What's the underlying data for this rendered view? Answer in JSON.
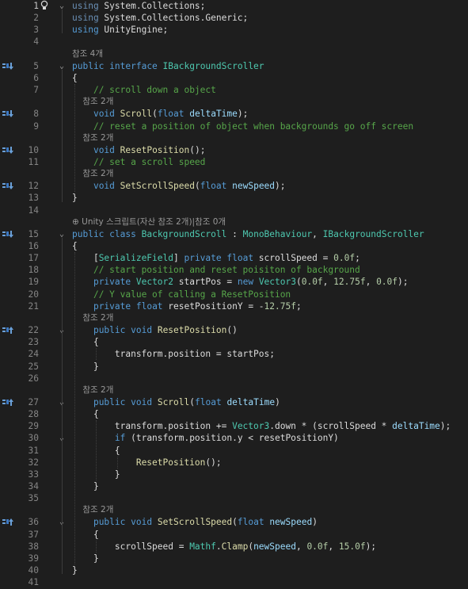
{
  "editor": {
    "language": "csharp",
    "current_line": 1,
    "colors": {
      "background": "#1e1e1e",
      "keyword": "#569cd6",
      "type": "#4ec9b0",
      "method": "#dcdcaa",
      "comment": "#57a64a",
      "number": "#b5cea8",
      "parameter": "#9cdcfe",
      "plain": "#dcdcdc",
      "line_number": "#858585",
      "codelens": "#999999"
    },
    "lines": [
      {
        "n": "1",
        "glyph": "",
        "tokens": [
          [
            "kw",
            "using"
          ],
          [
            "pl",
            " System.Collections;"
          ]
        ]
      },
      {
        "n": "2",
        "glyph": "",
        "tokens": [
          [
            "kw",
            "using"
          ],
          [
            "pl",
            " System.Collections.Generic;"
          ]
        ]
      },
      {
        "n": "3",
        "glyph": "",
        "tokens": [
          [
            "kw",
            "using"
          ],
          [
            "pl",
            " UnityEngine;"
          ]
        ]
      },
      {
        "n": "4",
        "glyph": "",
        "tokens": []
      },
      {
        "n": "",
        "lens": "참조 4개"
      },
      {
        "n": "5",
        "glyph": "impl-down",
        "tokens": [
          [
            "kw",
            "public"
          ],
          [
            "pl",
            " "
          ],
          [
            "kw",
            "interface"
          ],
          [
            "pl",
            " "
          ],
          [
            "ty",
            "IBackgroundScroller"
          ]
        ]
      },
      {
        "n": "6",
        "glyph": "",
        "tokens": [
          [
            "pl",
            "{"
          ]
        ]
      },
      {
        "n": "7",
        "glyph": "",
        "tokens": [
          [
            "pl",
            "    "
          ],
          [
            "cm",
            "// scroll down a object"
          ]
        ]
      },
      {
        "n": "",
        "lens": "    참조 2개"
      },
      {
        "n": "8",
        "glyph": "impl-down",
        "tokens": [
          [
            "pl",
            "    "
          ],
          [
            "kw",
            "void"
          ],
          [
            "pl",
            " "
          ],
          [
            "fn",
            "Scroll"
          ],
          [
            "pl",
            "("
          ],
          [
            "kw",
            "float"
          ],
          [
            "pl",
            " "
          ],
          [
            "pm",
            "deltaTime"
          ],
          [
            "pl",
            ");"
          ]
        ]
      },
      {
        "n": "9",
        "glyph": "",
        "tokens": [
          [
            "pl",
            "    "
          ],
          [
            "cm",
            "// reset a position of object when backgrounds go off screen"
          ]
        ]
      },
      {
        "n": "",
        "lens": "    참조 2개"
      },
      {
        "n": "10",
        "glyph": "impl-down",
        "tokens": [
          [
            "pl",
            "    "
          ],
          [
            "kw",
            "void"
          ],
          [
            "pl",
            " "
          ],
          [
            "fn",
            "ResetPosition"
          ],
          [
            "pl",
            "();"
          ]
        ]
      },
      {
        "n": "11",
        "glyph": "",
        "tokens": [
          [
            "pl",
            "    "
          ],
          [
            "cm",
            "// set a scroll speed"
          ]
        ]
      },
      {
        "n": "",
        "lens": "    참조 2개"
      },
      {
        "n": "12",
        "glyph": "impl-down",
        "tokens": [
          [
            "pl",
            "    "
          ],
          [
            "kw",
            "void"
          ],
          [
            "pl",
            " "
          ],
          [
            "fn",
            "SetScrollSpeed"
          ],
          [
            "pl",
            "("
          ],
          [
            "kw",
            "float"
          ],
          [
            "pl",
            " "
          ],
          [
            "pm",
            "newSpeed"
          ],
          [
            "pl",
            ");"
          ]
        ]
      },
      {
        "n": "13",
        "glyph": "",
        "tokens": [
          [
            "pl",
            "}"
          ]
        ]
      },
      {
        "n": "14",
        "glyph": "",
        "tokens": []
      },
      {
        "n": "",
        "lens": "⊕ Unity 스크립트(자산 참조 2개)|참조 0개"
      },
      {
        "n": "15",
        "glyph": "impl-down",
        "tokens": [
          [
            "kw",
            "public"
          ],
          [
            "pl",
            " "
          ],
          [
            "kw",
            "class"
          ],
          [
            "pl",
            " "
          ],
          [
            "ty",
            "BackgroundScroll"
          ],
          [
            "pl",
            " : "
          ],
          [
            "ty",
            "MonoBehaviour"
          ],
          [
            "pl",
            ", "
          ],
          [
            "ty",
            "IBackgroundScroller"
          ]
        ]
      },
      {
        "n": "16",
        "glyph": "",
        "tokens": [
          [
            "pl",
            "{"
          ]
        ]
      },
      {
        "n": "17",
        "glyph": "",
        "tokens": [
          [
            "pl",
            "    ["
          ],
          [
            "ty",
            "SerializeField"
          ],
          [
            "pl",
            "] "
          ],
          [
            "kw",
            "private"
          ],
          [
            "pl",
            " "
          ],
          [
            "kw",
            "float"
          ],
          [
            "pl",
            " scrollSpeed = "
          ],
          [
            "nu",
            "0.0f"
          ],
          [
            "pl",
            ";"
          ]
        ]
      },
      {
        "n": "18",
        "glyph": "",
        "tokens": [
          [
            "pl",
            "    "
          ],
          [
            "cm",
            "// start position and reset poisiton of background"
          ]
        ]
      },
      {
        "n": "19",
        "glyph": "",
        "tokens": [
          [
            "pl",
            "    "
          ],
          [
            "kw",
            "private"
          ],
          [
            "pl",
            " "
          ],
          [
            "ty",
            "Vector2"
          ],
          [
            "pl",
            " startPos = "
          ],
          [
            "kw",
            "new"
          ],
          [
            "pl",
            " "
          ],
          [
            "ty",
            "Vector3"
          ],
          [
            "pl",
            "("
          ],
          [
            "nu",
            "0.0f"
          ],
          [
            "pl",
            ", "
          ],
          [
            "nu",
            "12.75f"
          ],
          [
            "pl",
            ", "
          ],
          [
            "nu",
            "0.0f"
          ],
          [
            "pl",
            ");"
          ]
        ]
      },
      {
        "n": "20",
        "glyph": "",
        "tokens": [
          [
            "pl",
            "    "
          ],
          [
            "cm",
            "// Y value of calling a ResetPosition"
          ]
        ]
      },
      {
        "n": "21",
        "glyph": "",
        "tokens": [
          [
            "pl",
            "    "
          ],
          [
            "kw",
            "private"
          ],
          [
            "pl",
            " "
          ],
          [
            "kw",
            "float"
          ],
          [
            "pl",
            " resetPositionY = "
          ],
          [
            "pl",
            "-"
          ],
          [
            "nu",
            "12.75f"
          ],
          [
            "pl",
            ";"
          ]
        ]
      },
      {
        "n": "",
        "lens": "    참조 2개"
      },
      {
        "n": "22",
        "glyph": "impl-up",
        "tokens": [
          [
            "pl",
            "    "
          ],
          [
            "kw",
            "public"
          ],
          [
            "pl",
            " "
          ],
          [
            "kw",
            "void"
          ],
          [
            "pl",
            " "
          ],
          [
            "fn",
            "ResetPosition"
          ],
          [
            "pl",
            "()"
          ]
        ]
      },
      {
        "n": "23",
        "glyph": "",
        "tokens": [
          [
            "pl",
            "    {"
          ]
        ]
      },
      {
        "n": "24",
        "glyph": "",
        "tokens": [
          [
            "pl",
            "        transform.position = startPos;"
          ]
        ]
      },
      {
        "n": "25",
        "glyph": "",
        "tokens": [
          [
            "pl",
            "    }"
          ]
        ]
      },
      {
        "n": "26",
        "glyph": "",
        "tokens": []
      },
      {
        "n": "",
        "lens": "    참조 2개"
      },
      {
        "n": "27",
        "glyph": "impl-up",
        "tokens": [
          [
            "pl",
            "    "
          ],
          [
            "kw",
            "public"
          ],
          [
            "pl",
            " "
          ],
          [
            "kw",
            "void"
          ],
          [
            "pl",
            " "
          ],
          [
            "fn",
            "Scroll"
          ],
          [
            "pl",
            "("
          ],
          [
            "kw",
            "float"
          ],
          [
            "pl",
            " "
          ],
          [
            "pm",
            "deltaTime"
          ],
          [
            "pl",
            ")"
          ]
        ]
      },
      {
        "n": "28",
        "glyph": "",
        "tokens": [
          [
            "pl",
            "    {"
          ]
        ]
      },
      {
        "n": "29",
        "glyph": "",
        "tokens": [
          [
            "pl",
            "        transform.position += "
          ],
          [
            "ty",
            "Vector3"
          ],
          [
            "pl",
            ".down * (scrollSpeed * "
          ],
          [
            "pm",
            "deltaTime"
          ],
          [
            "pl",
            ");"
          ]
        ]
      },
      {
        "n": "30",
        "glyph": "",
        "tokens": [
          [
            "pl",
            "        "
          ],
          [
            "kw",
            "if"
          ],
          [
            "pl",
            " (transform.position.y < resetPositionY)"
          ]
        ]
      },
      {
        "n": "31",
        "glyph": "",
        "tokens": [
          [
            "pl",
            "        {"
          ]
        ]
      },
      {
        "n": "32",
        "glyph": "",
        "tokens": [
          [
            "pl",
            "            "
          ],
          [
            "fn",
            "ResetPosition"
          ],
          [
            "pl",
            "();"
          ]
        ]
      },
      {
        "n": "33",
        "glyph": "",
        "tokens": [
          [
            "pl",
            "        }"
          ]
        ]
      },
      {
        "n": "34",
        "glyph": "",
        "tokens": [
          [
            "pl",
            "    }"
          ]
        ]
      },
      {
        "n": "35",
        "glyph": "",
        "tokens": []
      },
      {
        "n": "",
        "lens": "    참조 2개"
      },
      {
        "n": "36",
        "glyph": "impl-up",
        "tokens": [
          [
            "pl",
            "    "
          ],
          [
            "kw",
            "public"
          ],
          [
            "pl",
            " "
          ],
          [
            "kw",
            "void"
          ],
          [
            "pl",
            " "
          ],
          [
            "fn",
            "SetScrollSpeed"
          ],
          [
            "pl",
            "("
          ],
          [
            "kw",
            "float"
          ],
          [
            "pl",
            " "
          ],
          [
            "pm",
            "newSpeed"
          ],
          [
            "pl",
            ")"
          ]
        ]
      },
      {
        "n": "37",
        "glyph": "",
        "tokens": [
          [
            "pl",
            "    {"
          ]
        ]
      },
      {
        "n": "38",
        "glyph": "",
        "tokens": [
          [
            "pl",
            "        scrollSpeed = "
          ],
          [
            "ty",
            "Mathf"
          ],
          [
            "pl",
            "."
          ],
          [
            "fn",
            "Clamp"
          ],
          [
            "pl",
            "("
          ],
          [
            "pm",
            "newSpeed"
          ],
          [
            "pl",
            ", "
          ],
          [
            "nu",
            "0.0f"
          ],
          [
            "pl",
            ", "
          ],
          [
            "nu",
            "15.0f"
          ],
          [
            "pl",
            ");"
          ]
        ]
      },
      {
        "n": "39",
        "glyph": "",
        "tokens": [
          [
            "pl",
            "    }"
          ]
        ]
      },
      {
        "n": "40",
        "glyph": "",
        "tokens": [
          [
            "pl",
            "}"
          ]
        ]
      },
      {
        "n": "41",
        "glyph": "",
        "tokens": []
      }
    ]
  }
}
